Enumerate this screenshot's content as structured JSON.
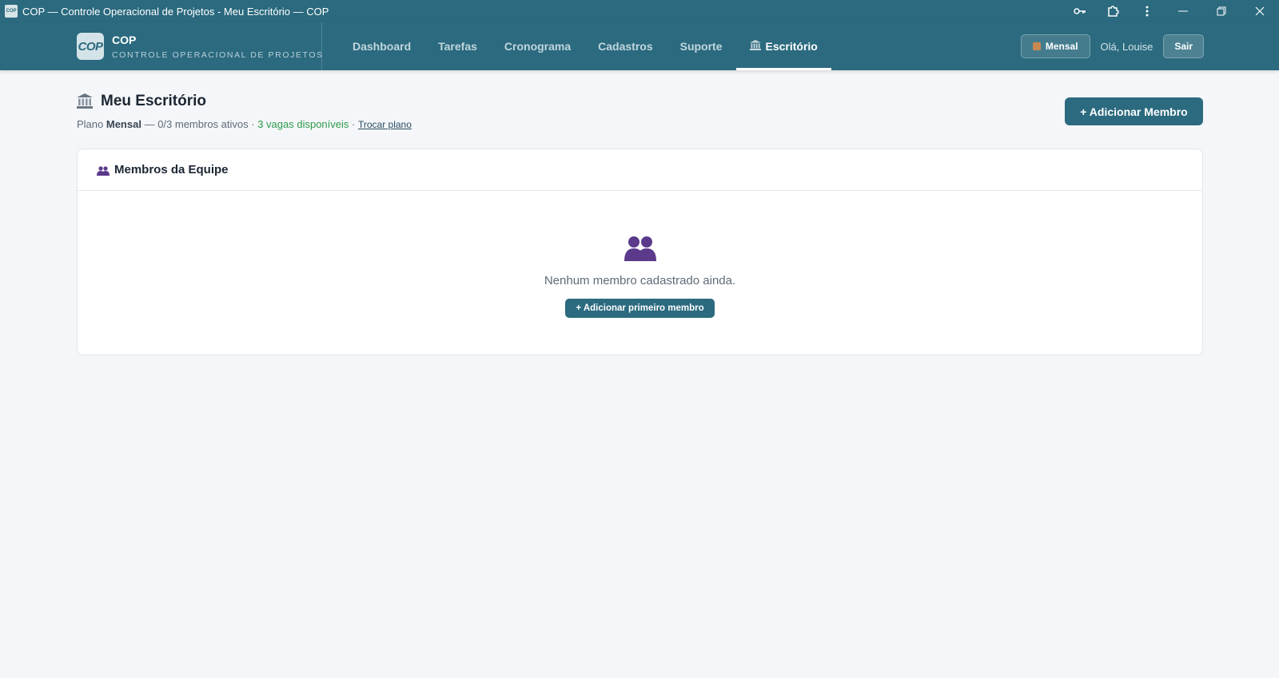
{
  "window": {
    "title": "COP — Controle Operacional de Projetos - Meu Escritório — COP",
    "app_icon_text": "COP",
    "icons": [
      "key-icon",
      "extension-icon",
      "kebab-menu-icon"
    ],
    "controls": [
      "minimize-icon",
      "restore-icon",
      "close-icon"
    ]
  },
  "brand": {
    "logo_text": "COP",
    "name": "COP",
    "subtitle": "CONTROLE OPERACIONAL DE PROJETOS"
  },
  "nav": {
    "links": [
      {
        "label": "Dashboard",
        "active": false
      },
      {
        "label": "Tarefas",
        "active": false
      },
      {
        "label": "Cronograma",
        "active": false
      },
      {
        "label": "Cadastros",
        "active": false
      },
      {
        "label": "Suporte",
        "active": false
      },
      {
        "label": "Escritório",
        "active": true,
        "icon": "bank-icon"
      }
    ],
    "plan_badge": "Mensal",
    "greeting": "Olá, Louise",
    "logout": "Sair"
  },
  "page": {
    "title": "Meu Escritório",
    "title_icon": "bank-icon",
    "plan_prefix": "Plano",
    "plan_name": "Mensal",
    "members_status": "— 0/3 membros ativos ·",
    "slots_available": "3 vagas disponíveis",
    "separator": "·",
    "change_plan": "Trocar plano",
    "add_member_button": "+ Adicionar Membro"
  },
  "team_card": {
    "title": "Membros da Equipe",
    "title_icon": "users-icon",
    "empty_icon": "users-icon",
    "empty_text": "Nenhum membro cadastrado ainda.",
    "add_first_button": "+ Adicionar primeiro membro"
  },
  "colors": {
    "primary": "#2b6a7f",
    "background": "#f4f6f9",
    "success_text": "#2e9b4b",
    "users_icon": "#5b3a8c"
  }
}
